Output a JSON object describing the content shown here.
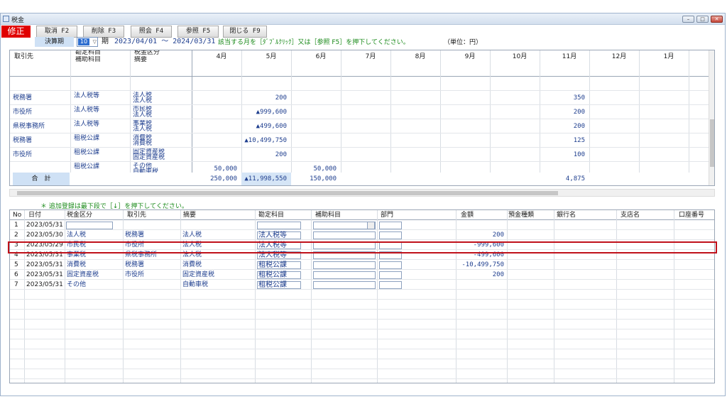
{
  "window": {
    "title": "税金"
  },
  "toolbar": {
    "mode": "修正",
    "buttons": [
      "取消 F2",
      "削除 F3",
      "照会 F4",
      "参照 F5",
      "閉じる F9"
    ]
  },
  "period": {
    "label": "決算期",
    "value": "10",
    "suffix": "期",
    "range": "2023/04/01 〜 2024/03/31",
    "hint": "該当する月を［ﾀﾞﾌﾞﾙｸﾘｯｸ］又は［参照 F5］を押下してください。",
    "unit": "（単位：円）"
  },
  "summary": {
    "headers": {
      "partner": "取引先",
      "account": "勘定科目",
      "sub_account": "補助科目",
      "tax_type": "税金区分",
      "memo": "摘要",
      "months": [
        "4月",
        "5月",
        "6月",
        "7月",
        "8月",
        "9月",
        "10月",
        "11月",
        "12月",
        "1月"
      ]
    },
    "rows": [
      {
        "partner": "税務署",
        "account": "法人税等",
        "tax1": "法人税",
        "tax2": "法人税",
        "may": "200",
        "nov": "350"
      },
      {
        "partner": "市役所",
        "account": "法人税等",
        "tax1": "市民税",
        "tax2": "法人税",
        "may": "▲999,600",
        "nov": "200"
      },
      {
        "partner": "県税事務所",
        "account": "法人税等",
        "tax1": "事業税",
        "tax2": "法人税",
        "may": "▲499,600",
        "nov": "200"
      },
      {
        "partner": "税務署",
        "account": "租税公課",
        "tax1": "消費税",
        "tax2": "消費税",
        "may": "▲10,499,750",
        "nov": "125"
      },
      {
        "partner": "市役所",
        "account": "租税公課",
        "tax1": "固定資産税",
        "tax2": "固定資産税",
        "may": "200",
        "nov": "100"
      },
      {
        "partner": "",
        "account": "租税公課",
        "tax1": "その他",
        "tax2": "自動車税",
        "apr": "50,000",
        "jun": "50,000"
      }
    ],
    "total": {
      "label": "合　計",
      "apr": "250,000",
      "may": "▲11,998,550",
      "jun": "150,000",
      "nov": "4,875"
    }
  },
  "note": "＊ 追加登録は最下段で［↓］を押下してください。",
  "detail": {
    "headers": [
      "No",
      "日付",
      "税金区分",
      "取引先",
      "摘要",
      "勘定科目",
      "補助科目",
      "部門",
      "金額",
      "預金種類",
      "銀行名",
      "支店名",
      "口座番号"
    ],
    "rows": [
      {
        "no": "1",
        "date": "2023/05/31",
        "tax": "",
        "partner": "",
        "memo": "",
        "account": "",
        "amount": ""
      },
      {
        "no": "2",
        "date": "2023/05/30",
        "tax": "法人税",
        "partner": "税務署",
        "memo": "法人税",
        "account": "法人税等",
        "amount": "200"
      },
      {
        "no": "3",
        "date": "2023/05/29",
        "tax": "市民税",
        "partner": "市役所",
        "memo": "法人税",
        "account": "法人税等",
        "amount": "-999,600"
      },
      {
        "no": "4",
        "date": "2023/05/31",
        "tax": "事業税",
        "partner": "県税事務所",
        "memo": "法人税",
        "account": "法人税等",
        "amount": "-499,600"
      },
      {
        "no": "5",
        "date": "2023/05/31",
        "tax": "消費税",
        "partner": "税務署",
        "memo": "消費税",
        "account": "租税公課",
        "amount": "-10,499,750"
      },
      {
        "no": "6",
        "date": "2023/05/31",
        "tax": "固定資産税",
        "partner": "市役所",
        "memo": "固定資産税",
        "account": "租税公課",
        "amount": "200"
      },
      {
        "no": "7",
        "date": "2023/05/31",
        "tax": "その他",
        "partner": "",
        "memo": "自動車税",
        "account": "租税公課",
        "amount": ""
      }
    ]
  }
}
